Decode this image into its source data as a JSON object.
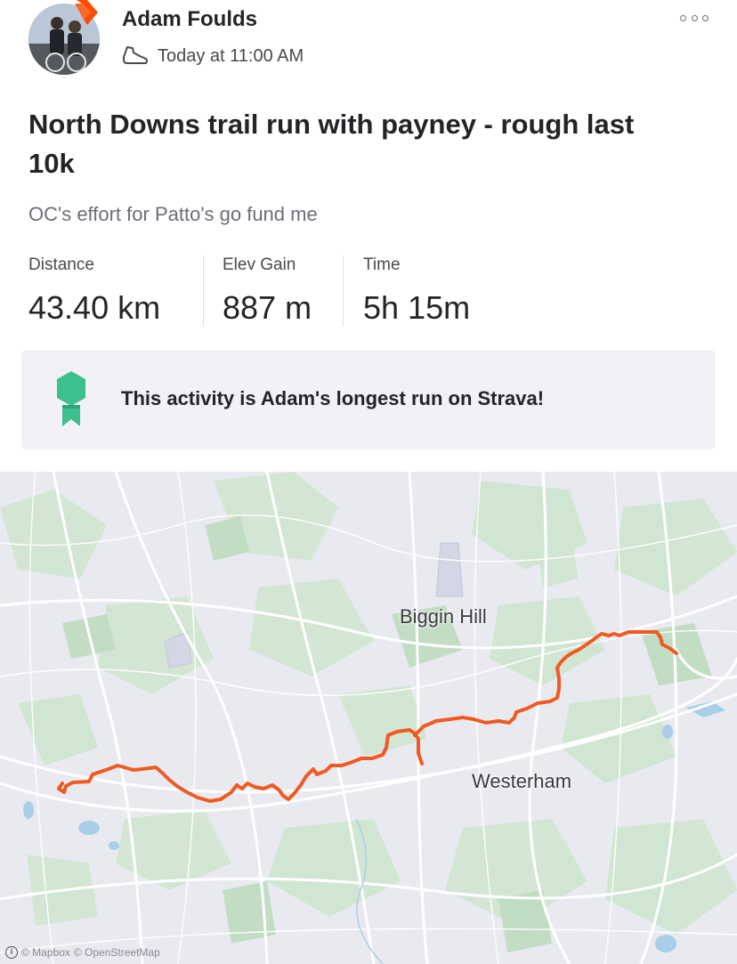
{
  "post": {
    "athlete_name": "Adam Foulds",
    "timestamp": "Today at 11:00 AM",
    "activity_icon": "shoe-icon",
    "menu_icon": "more-icon",
    "title": "North Downs trail run with payney - rough last 10k",
    "description": "OC's effort for Patto's go fund me"
  },
  "stats": [
    {
      "label": "Distance",
      "value": "43.40 km"
    },
    {
      "label": "Elev Gain",
      "value": "887 m"
    },
    {
      "label": "Time",
      "value": "5h 15m"
    }
  ],
  "achievement": {
    "icon": "medal-icon",
    "text": "This activity is Adam's longest run on Strava!"
  },
  "map": {
    "labels": {
      "biggin_hill": "Biggin Hill",
      "westerham": "Westerham"
    },
    "attribution": {
      "mapbox": "© Mapbox",
      "osm": "© OpenStreetMap"
    },
    "route_color": "#f05a22"
  },
  "colors": {
    "brand": "#fc4c02",
    "medal": "#3dbf8e",
    "route": "#f05a22"
  }
}
